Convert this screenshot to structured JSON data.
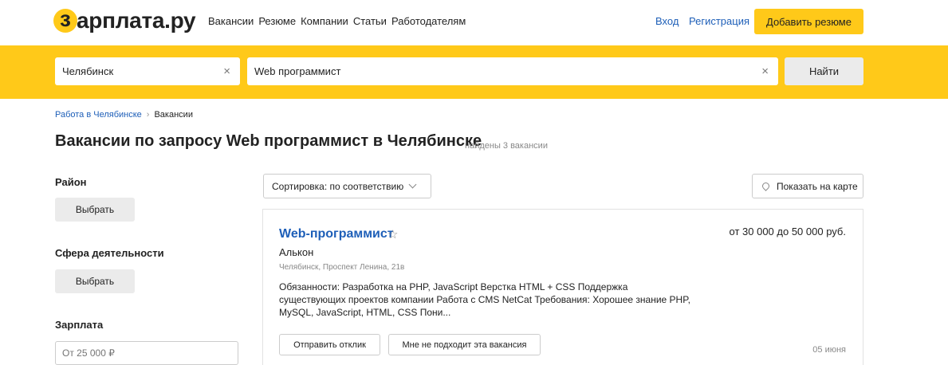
{
  "header": {
    "logo_letter": "з",
    "logo_text": "арплата.ру",
    "nav": [
      "Вакансии",
      "Резюме",
      "Компании",
      "Статьи",
      "Работодателям"
    ],
    "login": "Вход",
    "register": "Регистрация",
    "add_resume": "Добавить резюме"
  },
  "search": {
    "city_value": "Челябинск",
    "query_value": "Web программист",
    "clear_symbol": "×",
    "find_label": "Найти"
  },
  "breadcrumb": {
    "link": "Работа в Челябинске",
    "separator": "›",
    "current": "Вакансии"
  },
  "page": {
    "title": "Вакансии по запросу Web программист в Челябинске",
    "found": "найдены 3 вакансии"
  },
  "filters": {
    "district_label": "Район",
    "district_button": "Выбрать",
    "sphere_label": "Сфера деятельности",
    "sphere_button": "Выбрать",
    "salary_label": "Зарплата",
    "salary_placeholder": "От 25 000 ₽"
  },
  "toolbar": {
    "sort_label": "Сортировка: по соответствию",
    "map_label": "Показать на карте"
  },
  "vacancy": {
    "title": "Web-программист",
    "salary": "от 30 000 до 50 000 руб.",
    "company": "Алькон",
    "address": "Челябинск, Проспект Ленина, 21в",
    "description": "Обязанности: Разработка на PHP, JavaScript Верстка HTML + CSS Поддержка существующих проектов компании Работа с CMS NetCat Требования: Хорошее знание PHP, MySQL, JavaScript, HTML, CSS Пони...",
    "respond_button": "Отправить отклик",
    "reject_button": "Мне не подходит эта вакансия",
    "date": "05 июня"
  },
  "colors": {
    "accent": "#ffc919",
    "link": "#1e5fb8"
  }
}
